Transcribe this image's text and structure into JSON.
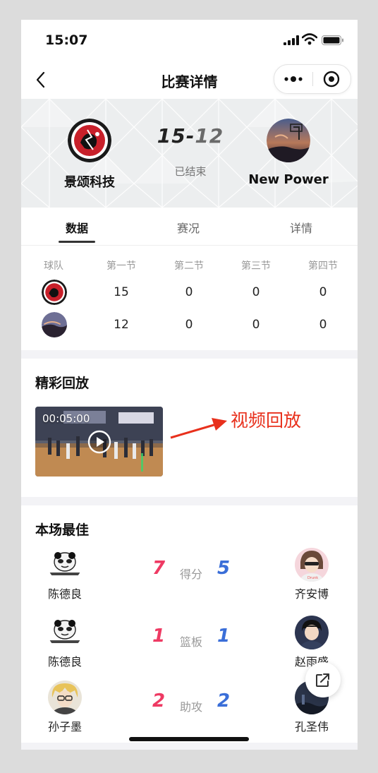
{
  "status_bar": {
    "time": "15:07"
  },
  "nav": {
    "title": "比赛详情"
  },
  "match": {
    "home_team": "景颂科技",
    "away_team": "New Power",
    "home_score": "15",
    "separator": "-",
    "away_score": "12",
    "status": "已结束"
  },
  "tabs": [
    {
      "label": "数据",
      "active": true
    },
    {
      "label": "赛况",
      "active": false
    },
    {
      "label": "详情",
      "active": false
    }
  ],
  "quarters": {
    "headers": [
      "球队",
      "第一节",
      "第二节",
      "第三节",
      "第四节"
    ],
    "rows": [
      {
        "team": "景颂科技",
        "scores": [
          "15",
          "0",
          "0",
          "0"
        ]
      },
      {
        "team": "New Power",
        "scores": [
          "12",
          "0",
          "0",
          "0"
        ]
      }
    ]
  },
  "highlights": {
    "title": "精彩回放",
    "video_duration": "00:05:00",
    "annotation": "视频回放",
    "accent_color": "#e8301c"
  },
  "best": {
    "title": "本场最佳",
    "rows": [
      {
        "stat": "得分",
        "home_player": "陈德良",
        "home_value": "7",
        "away_player": "齐安博",
        "away_value": "5"
      },
      {
        "stat": "篮板",
        "home_player": "陈德良",
        "home_value": "1",
        "away_player": "赵雨盛",
        "away_value": "1"
      },
      {
        "stat": "助攻",
        "home_player": "孙子墨",
        "home_value": "2",
        "away_player": "孔圣伟",
        "away_value": "2"
      }
    ],
    "home_color": "#ee3a63",
    "away_color": "#3a6ed8"
  }
}
